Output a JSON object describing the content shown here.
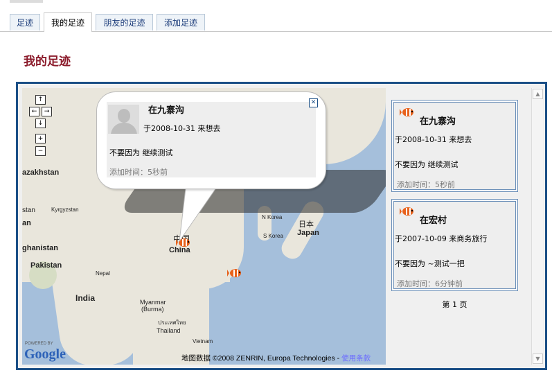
{
  "tabs": [
    {
      "label": "足迹"
    },
    {
      "label": "我的足迹"
    },
    {
      "label": "朋友的足迹"
    },
    {
      "label": "添加足迹"
    }
  ],
  "page_title": "我的足迹",
  "map": {
    "nav": {
      "up": "↑",
      "left": "←",
      "right": "→",
      "down": "↓",
      "zoom_in": "+",
      "zoom_out": "−"
    },
    "labels": {
      "kazakhstan": "azakhstan",
      "kyrgyzstan": "Kyrgyzstan",
      "stan": "stan",
      "an": "an",
      "afghanistan": "ghanistan",
      "pakistan": "Pakistan",
      "nepal": "Nepal",
      "india": "India",
      "china_cn": "中国",
      "china_en": "China",
      "n_korea": "N Korea",
      "s_korea": "S Korea",
      "japan_cn": "日本",
      "japan_en": "Japan",
      "myanmar": "Myanmar",
      "burma": "(Burma)",
      "thailand_cn": "ประเทศไทย",
      "thailand_en": "Thailand",
      "vietnam": "Vietnam"
    },
    "powered_by": "POWERED BY",
    "google_logo": "Google",
    "copyright_prefix": "地图数据",
    "copyright": "©2008 ZENRIN, Europa Technologies -",
    "terms_link": "使用条款"
  },
  "popup": {
    "title": "在九寨沟",
    "date_line": "于2008-10-31 来想去",
    "message": "不要因为  继续测试",
    "added": "添加时间：5秒前"
  },
  "list": [
    {
      "title": "在九寨沟",
      "date_line": "于2008-10-31 来想去",
      "message": "不要因为  继续测试",
      "added": "添加时间：5秒前"
    },
    {
      "title": "在宏村",
      "date_line": "于2007-10-09 来商务旅行",
      "message": "不要因为  ~测试一把",
      "added": "添加时间：6分钟前"
    }
  ],
  "pager": "第 1 页",
  "scroll": {
    "up": "▲",
    "down": "▼"
  },
  "colors": {
    "accent": "#8b1a2a",
    "frame": "#1b4f86",
    "sea": "#a5bfdb",
    "land": "#e9e6dc"
  }
}
